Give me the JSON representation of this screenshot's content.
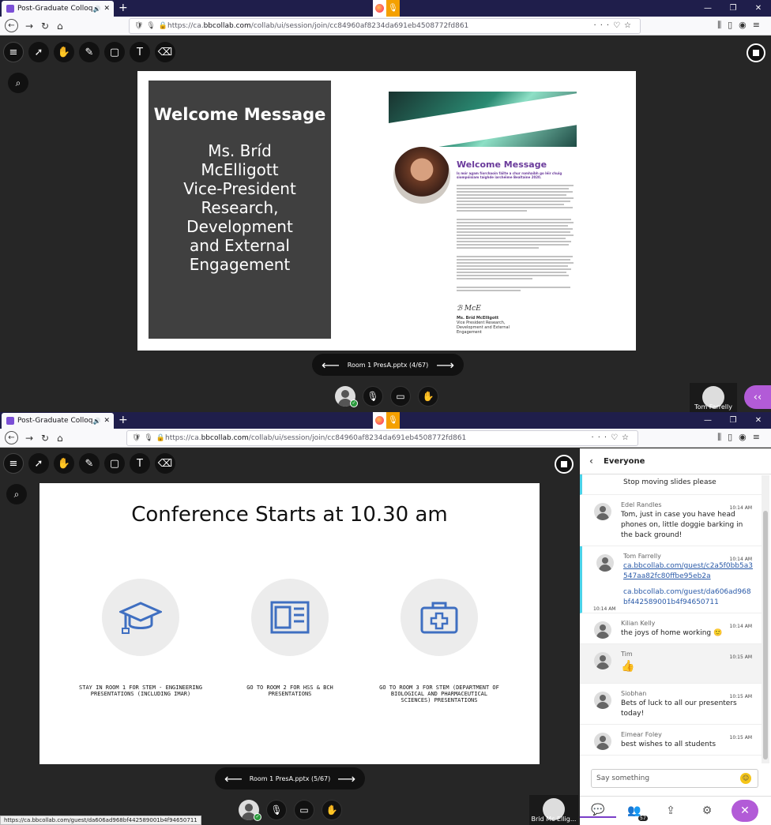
{
  "browser": {
    "tab_title": "Post-Graduate Colloquium",
    "url_prefix": "https://ca.",
    "url_domain": "bbcollab.com",
    "url_path": "/collab/ui/session/join/cc84960af8234da691eb4508772fd861"
  },
  "session1": {
    "slide_nav": "Room 1 PresA.pptx   (4/67)",
    "tile_name": "Tom Farrelly",
    "slide": {
      "left_title": "Welcome Message",
      "left_body": "Ms.  Bríd\nMcElligott\nVice-President\nResearch,\nDevelopment\nand External\nEngagement",
      "right_title": "Welcome Message",
      "right_sub": "Is mór agam fíorchaoin fáilte a chur romhaibh go léir chuig siompóisiam taighde iarchéime Bealtaine 2020.",
      "sig_name": "Ms. Bríd McElligott",
      "sig_role": "Vice President Research, Development and External Engagement"
    }
  },
  "session2": {
    "slide_nav": "Room 1 PresA.pptx   (5/67)",
    "tile_name": "Brid Mc Ellig...",
    "slide": {
      "title": "Conference Starts at 10.30 am",
      "captions": [
        "STAY IN ROOM 1 FOR STEM - ENGINEERING PRESENTATIONS (INCLUDING IMAR)",
        "GO TO ROOM 2 FOR HSS & BCH PRESENTATIONS",
        "GO TO ROOM 3 FOR STEM (DEPARTMENT OF BIOLOGICAL AND PHARMACEUTICAL SCIENCES) PRESENTATIONS"
      ]
    }
  },
  "chat": {
    "header": "Everyone",
    "messages": [
      {
        "text": "Stop moving slides please"
      },
      {
        "name": "Edel Randles",
        "time": "10:14 AM",
        "text": "Tom, just in case you have head phones on, little doggie barking in the back ground!"
      },
      {
        "name": "Tom Farrelly",
        "time": "10:14 AM",
        "link1": "ca.bbcollab.com/guest/c2a5f0bb5a3547aa82fc80ffbe95eb2a",
        "time2": "10:14 AM",
        "link2": "ca.bbcollab.com/guest/da606ad968bf442589001b4f94650711"
      },
      {
        "name": "Kilian Kelly",
        "time": "10:14 AM",
        "text": "the joys of home working 🙂"
      },
      {
        "name": "Tim",
        "time": "10:15 AM",
        "text": "👍"
      },
      {
        "name": "Siobhan",
        "time": "10:15 AM",
        "text": "Bets of luck to all our presenters today!"
      },
      {
        "name": "Eimear Foley",
        "time": "10:15 AM",
        "text": "best wishes to all students"
      }
    ],
    "input_placeholder": "Say something",
    "attendee_count": "57"
  },
  "status_url": "https://ca.bbcollab.com/guest/da606ad968bf442589001b4f94650711",
  "colors": {
    "accent": "#b25bd7",
    "chat_highlight": "#4ad3e9",
    "slide_purple": "#6a3a9b",
    "icon_blue": "#3f6fc1"
  }
}
